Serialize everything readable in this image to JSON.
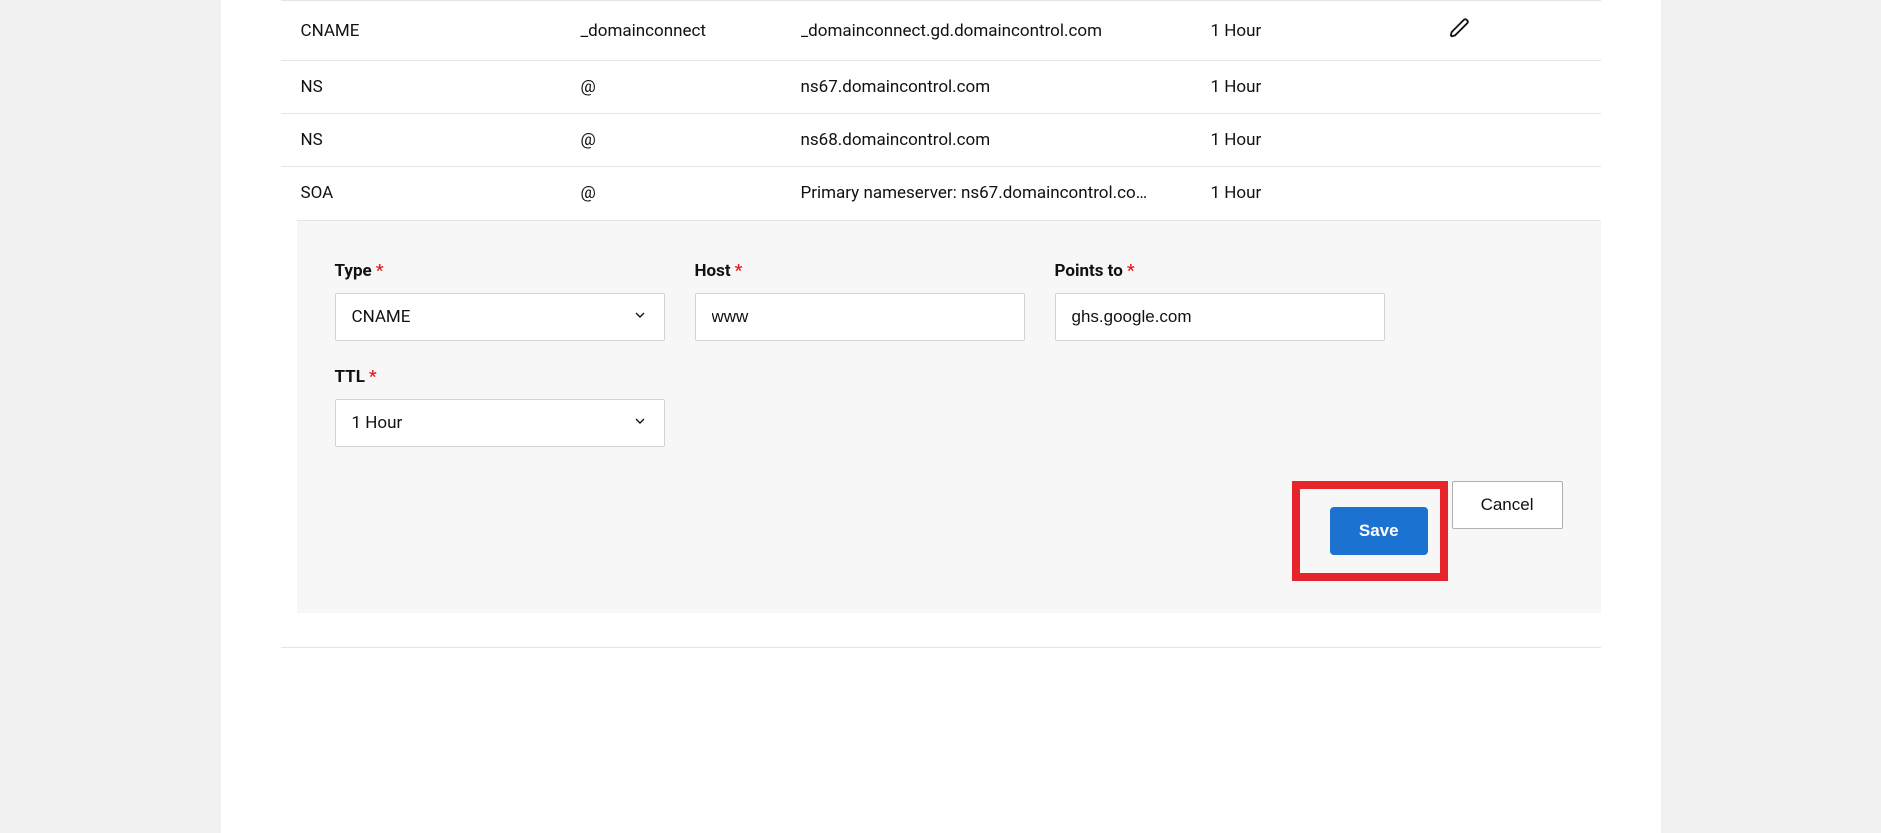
{
  "records": [
    {
      "type": "CNAME",
      "host": "_domainconnect",
      "value": "_domainconnect.gd.domaincontrol.com",
      "ttl": "1 Hour",
      "editable": true
    },
    {
      "type": "NS",
      "host": "@",
      "value": "ns67.domaincontrol.com",
      "ttl": "1 Hour",
      "editable": false
    },
    {
      "type": "NS",
      "host": "@",
      "value": "ns68.domaincontrol.com",
      "ttl": "1 Hour",
      "editable": false
    },
    {
      "type": "SOA",
      "host": "@",
      "value": "Primary nameserver: ns67.domaincontrol.co…",
      "ttl": "1 Hour",
      "editable": false
    }
  ],
  "form": {
    "type_label": "Type",
    "type_value": "CNAME",
    "host_label": "Host",
    "host_value": "www",
    "points_label": "Points to",
    "points_value": "ghs.google.com",
    "ttl_label": "TTL",
    "ttl_value": "1 Hour",
    "save_label": "Save",
    "cancel_label": "Cancel"
  }
}
